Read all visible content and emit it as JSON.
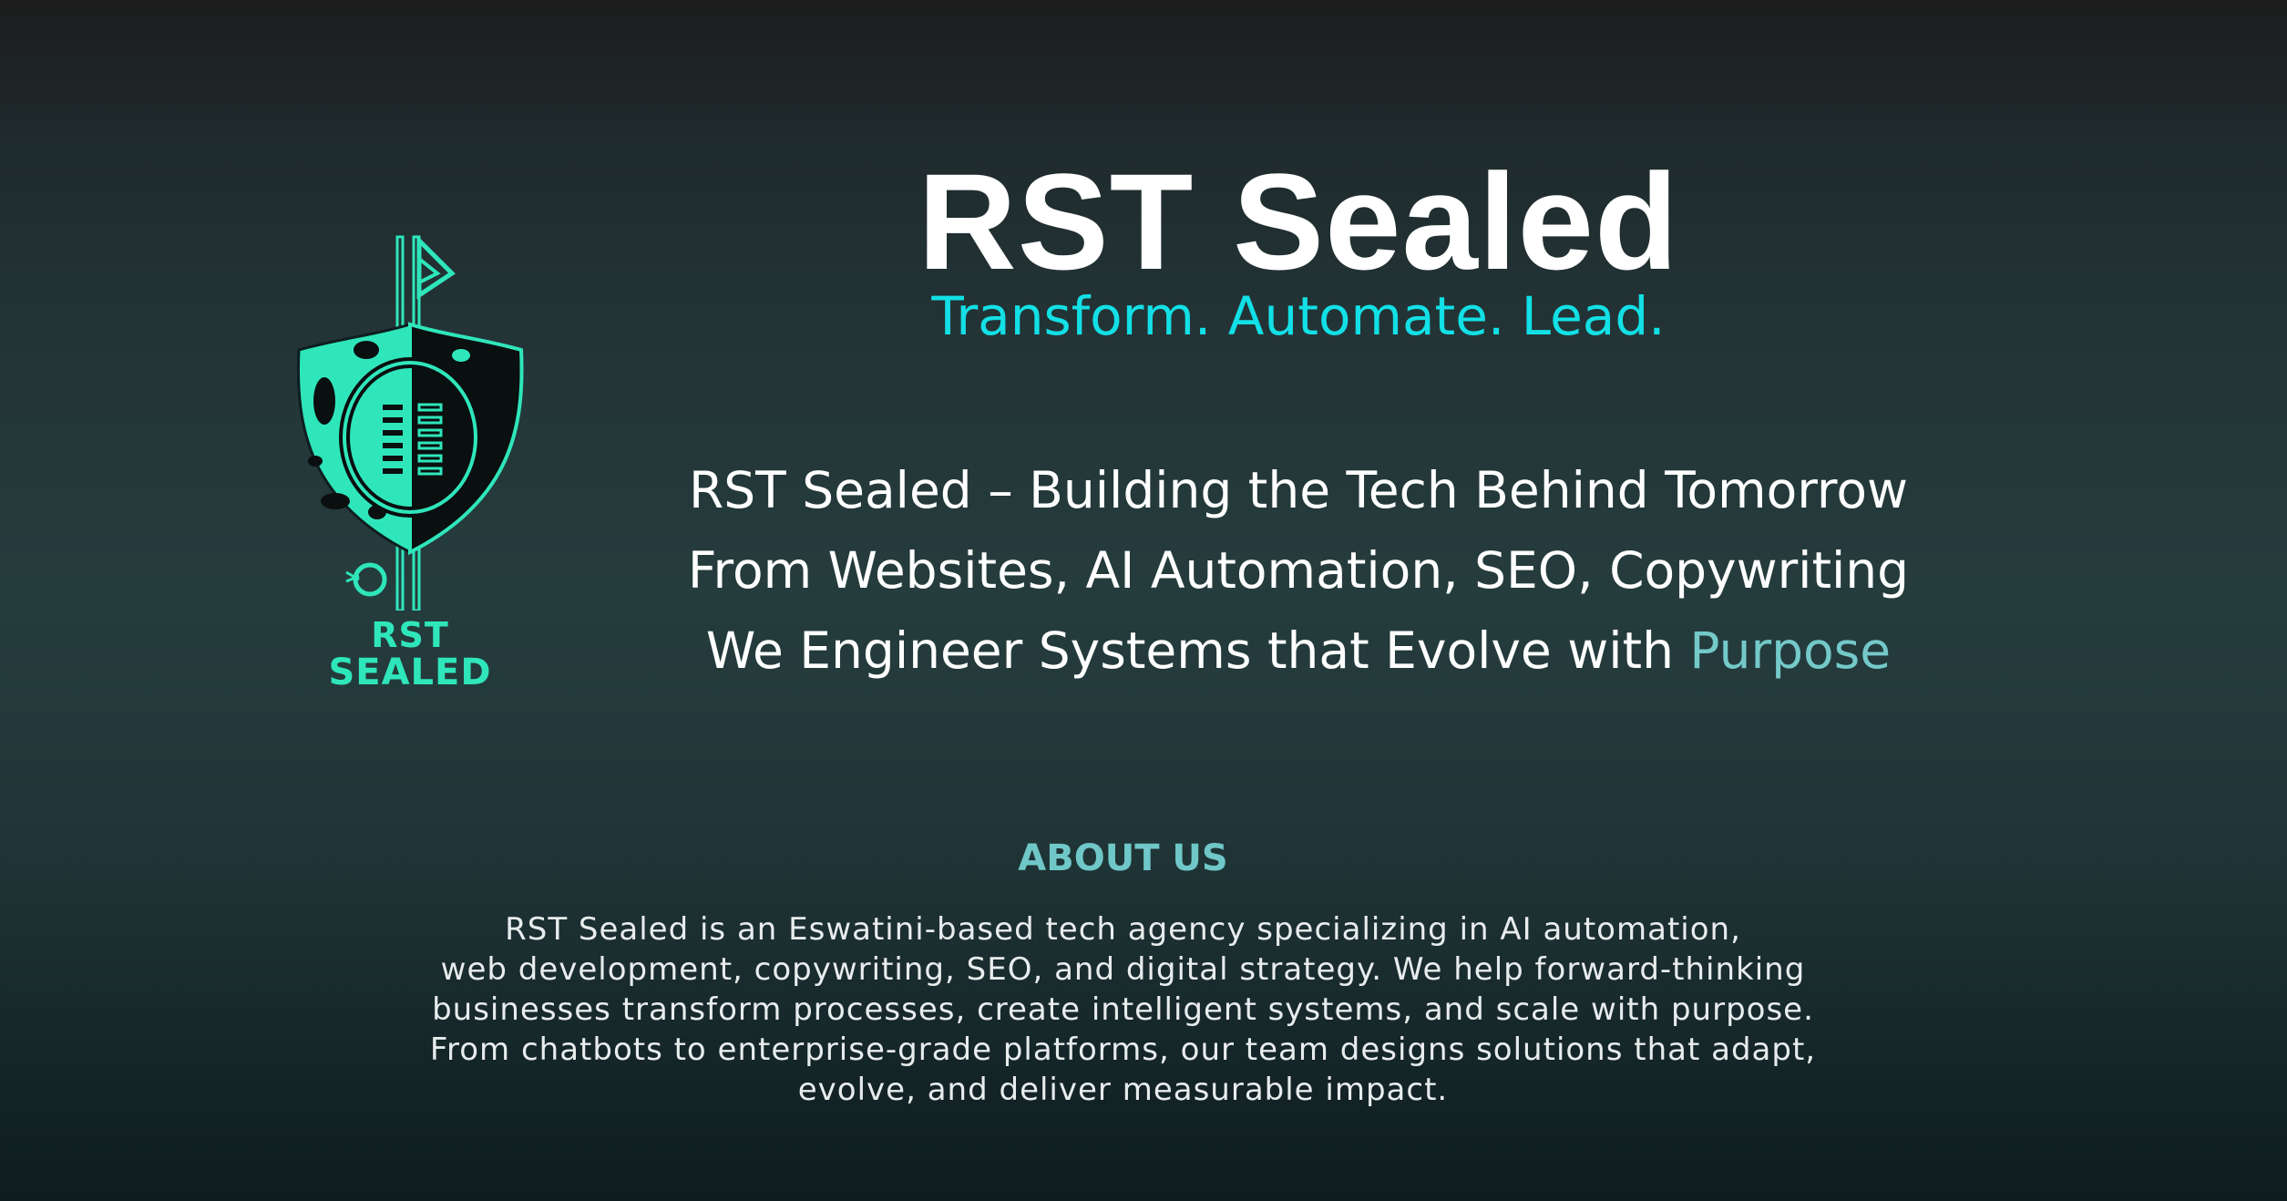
{
  "brand": {
    "logo_line1": "RST",
    "logo_line2": "SEALED",
    "accent_color": "#2fe6bb",
    "logo_icon": "shield-spear-icon"
  },
  "hero": {
    "title": "RST Sealed",
    "tagline": "Transform. Automate. Lead.",
    "line1": "RST Sealed – Building the Tech Behind Tomorrow",
    "line2": "From Websites, AI Automation, SEO, Copywriting",
    "line3_prefix": "We Engineer Systems that Evolve with ",
    "line3_accent": "Purpose",
    "tagline_color": "#12e0e6",
    "accent_color": "#74c9c9"
  },
  "about": {
    "heading": "ABOUT US",
    "lines": [
      "RST Sealed is an Eswatini-based tech agency specializing in AI automation,",
      "web development, copywriting, SEO, and digital strategy. We help forward-thinking",
      "businesses transform processes, create intelligent systems, and scale with purpose.",
      "From chatbots to enterprise-grade platforms, our team designs solutions that adapt,",
      "evolve, and deliver measurable impact."
    ]
  }
}
